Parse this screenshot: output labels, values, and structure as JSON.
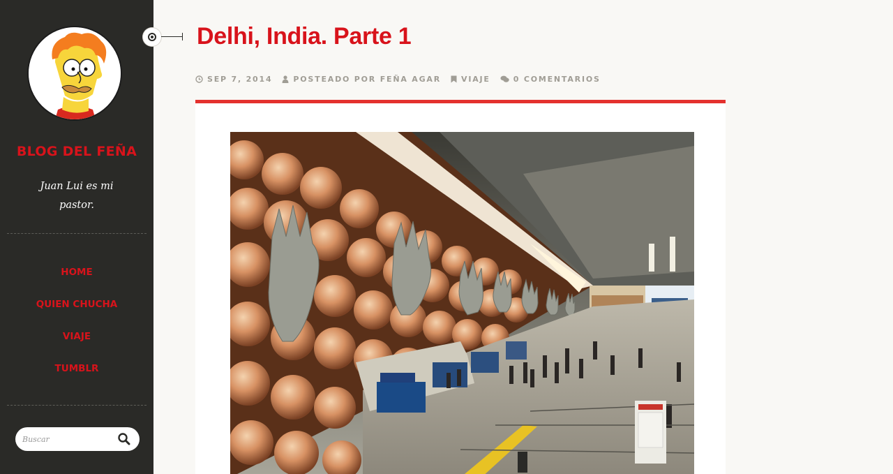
{
  "site": {
    "title": "BLOG DEL FEÑA",
    "tagline": "Juan Lui es mi pastor.",
    "avatar_icon": "cartoon-face-avatar"
  },
  "nav": {
    "items": [
      {
        "label": "HOME"
      },
      {
        "label": "QUIEN CHUCHA"
      },
      {
        "label": "VIAJE"
      },
      {
        "label": "TUMBLR"
      }
    ]
  },
  "search": {
    "placeholder": "Buscar",
    "icon": "search-icon"
  },
  "post": {
    "title": "Delhi, India. Parte 1",
    "meta": {
      "date": "SEP 7, 2014",
      "author": "POSTEADO POR FEÑA AGAR",
      "category": "VIAJE",
      "comments": "0 COMENTARIOS"
    },
    "image_icon": "airport-hall-photo"
  },
  "colors": {
    "accent": "#d8131b",
    "sidebar_bg": "#2a2a27",
    "card_border": "#e4312e",
    "meta_text": "#a09d95",
    "page_bg": "#f9f8f5"
  }
}
